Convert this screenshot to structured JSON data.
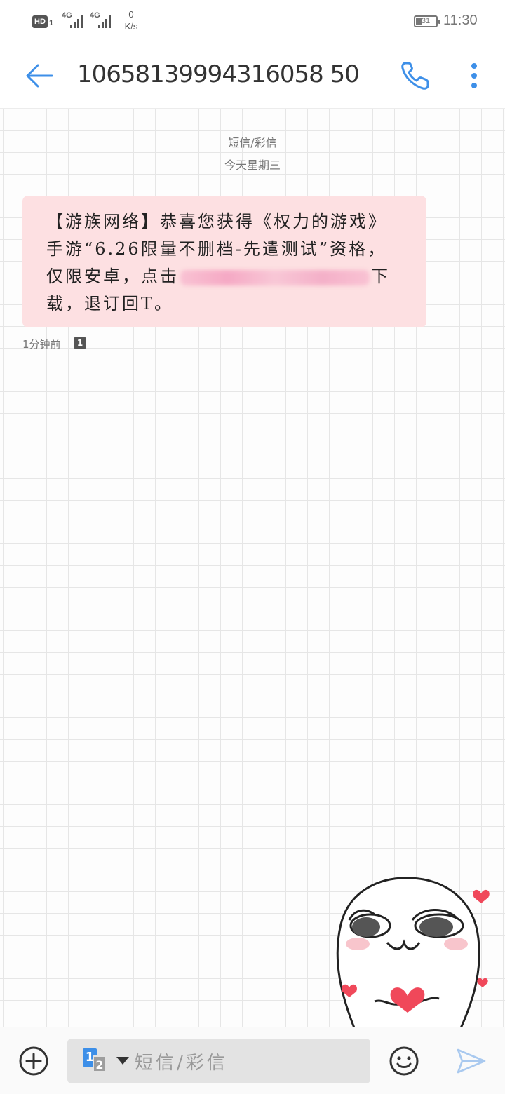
{
  "status_bar": {
    "hd": "HD",
    "sim_slot": "1",
    "network_1": "4G",
    "network_2": "4G",
    "speed_value": "0",
    "speed_unit": "K/s",
    "battery": "31",
    "time": "11:30"
  },
  "header": {
    "title": "10658139994316058 50",
    "back_icon": "arrow-left-icon",
    "call_icon": "phone-icon",
    "more_icon": "more-vertical-icon"
  },
  "conversation": {
    "category": "短信/彩信",
    "date": "今天星期三",
    "message": {
      "text_before": "【游族网络】恭喜您获得《权力的游戏》手游“6.26限量不删档-先遣测试”资格，仅限安卓，点击",
      "text_after": "下载，退订回T。",
      "time": "1分钟前",
      "sim": "1"
    }
  },
  "composer": {
    "placeholder": "短信/彩信",
    "sim_primary": "1",
    "sim_secondary": "2"
  },
  "colors": {
    "accent": "#3d8fe8",
    "bubble": "#fde0e2",
    "heart": "#f0485a"
  }
}
